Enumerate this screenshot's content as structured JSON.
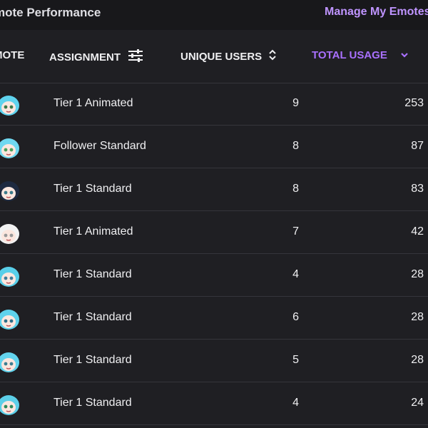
{
  "page": {
    "title": "mote Performance",
    "manage_link": "Manage My Emotes",
    "colors": {
      "background": "#1f1f23",
      "topbar": "#18181b",
      "accent": "#a970ff",
      "link": "#bf94ff",
      "divider": "#35353b"
    }
  },
  "table": {
    "columns": {
      "emote": "MOTE",
      "assignment": "ASSIGNMENT",
      "unique_users": "UNIQUE USERS",
      "total_usage": "TOTAL USAGE"
    },
    "sort": {
      "column": "total_usage",
      "direction": "descending"
    },
    "rows": [
      {
        "emote_icon": "emote-animated-icon",
        "assignment": "Tier 1 Animated",
        "unique_users": "9",
        "total_usage": "253"
      },
      {
        "emote_icon": "emote-follower-icon",
        "assignment": "Follower Standard",
        "unique_users": "8",
        "total_usage": "87"
      },
      {
        "emote_icon": "emote-hooded-icon",
        "assignment": "Tier 1 Standard",
        "unique_users": "8",
        "total_usage": "83"
      },
      {
        "emote_icon": "emote-white-icon",
        "assignment": "Tier 1 Animated",
        "unique_users": "7",
        "total_usage": "42"
      },
      {
        "emote_icon": "emote-teal-hair-icon",
        "assignment": "Tier 1 Standard",
        "unique_users": "4",
        "total_usage": "28"
      },
      {
        "emote_icon": "emote-shocked-icon",
        "assignment": "Tier 1 Standard",
        "unique_users": "6",
        "total_usage": "28"
      },
      {
        "emote_icon": "emote-wink-icon",
        "assignment": "Tier 1 Standard",
        "unique_users": "5",
        "total_usage": "28"
      },
      {
        "emote_icon": "emote-glasses-icon",
        "assignment": "Tier 1 Standard",
        "unique_users": "4",
        "total_usage": "24"
      }
    ]
  }
}
